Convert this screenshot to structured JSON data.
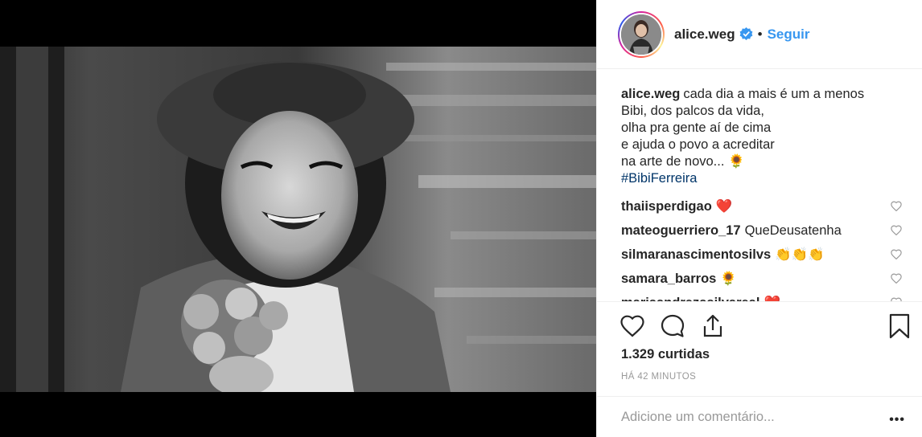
{
  "post": {
    "username": "alice.weg",
    "follow_label": "Seguir",
    "separator": "•",
    "caption_lines": [
      "cada dia a mais é um a menos",
      "Bibi, dos palcos da vida,",
      "olha pra gente aí de cima",
      "e ajuda o povo a acreditar",
      "na arte de novo..."
    ],
    "caption_emoji": "🌻",
    "hashtag": "#BibiFerreira",
    "likes": "1.329 curtidas",
    "time": "HÁ 42 MINUTOS"
  },
  "comments": [
    {
      "user": "thaiisperdigao",
      "text": "❤️"
    },
    {
      "user": "mateoguerriero_17",
      "text": "QueDeusatenha"
    },
    {
      "user": "silmaranascimentosilvs",
      "text": "👏👏👏"
    },
    {
      "user": "samara_barros",
      "text": "🌻"
    },
    {
      "user": "mariaandrezasilvareal",
      "text": "❤️"
    }
  ],
  "add_comment": {
    "placeholder": "Adicione um comentário...",
    "more": "•••"
  },
  "icons": {
    "verified": "verified-badge-icon",
    "like": "heart-icon",
    "comment": "comment-bubble-icon",
    "share": "share-icon",
    "save": "bookmark-icon"
  },
  "colors": {
    "accent": "#3897f0",
    "hashtag": "#003569",
    "border": "#efefef",
    "muted": "#999999"
  }
}
